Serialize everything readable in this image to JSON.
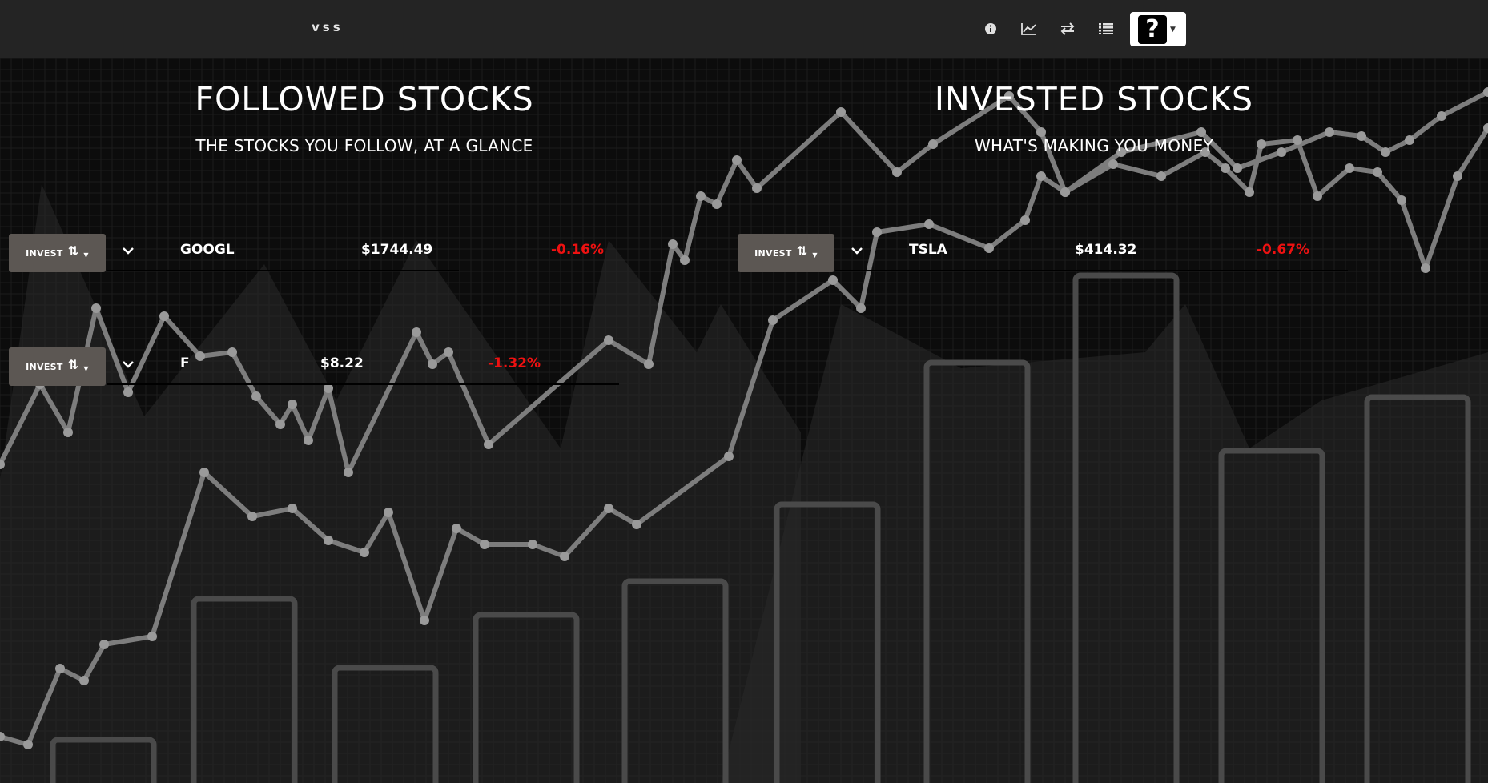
{
  "navbar": {
    "brand": "vss",
    "icons": [
      "info-icon",
      "line-chart-icon",
      "exchange-icon",
      "list-icon"
    ],
    "help_button": {
      "glyph": "?"
    }
  },
  "followed": {
    "title": "FOLLOWED STOCKS",
    "subtitle": "THE STOCKS YOU FOLLOW, AT A GLANCE",
    "rows": [
      {
        "invest_label": "INVEST",
        "symbol": "GOOGL",
        "price": "$1744.49",
        "change": "-0.16%"
      },
      {
        "invest_label": "INVEST",
        "symbol": "F",
        "price": "$8.22",
        "change": "-1.32%"
      }
    ]
  },
  "invested": {
    "title": "INVESTED STOCKS",
    "subtitle": "WHAT'S MAKING YOU MONEY",
    "rows": [
      {
        "invest_label": "INVEST",
        "symbol": "TSLA",
        "price": "$414.32",
        "change": "-0.67%"
      }
    ]
  },
  "colors": {
    "navbar": "#242424",
    "invest_button": "#5c5753",
    "negative_change": "#ee1111"
  }
}
